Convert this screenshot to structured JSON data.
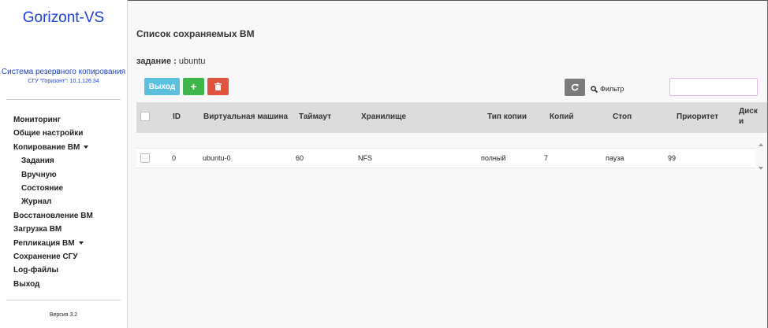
{
  "sidebar": {
    "brand": "Gorizont-VS",
    "subtitle": "Система резервного копирования",
    "server": "СГУ \"Горизонт\": 10.1.126.34",
    "items": [
      {
        "label": "Мониторинг"
      },
      {
        "label": "Общие настройки"
      },
      {
        "label": "Копирование ВМ"
      },
      {
        "label": "Задания"
      },
      {
        "label": "Вручную"
      },
      {
        "label": "Состояние"
      },
      {
        "label": "Журнал"
      },
      {
        "label": "Восстановление ВМ"
      },
      {
        "label": "Загрузка ВМ"
      },
      {
        "label": "Репликация ВМ"
      },
      {
        "label": "Сохранение СГУ"
      },
      {
        "label": "Log-файлы"
      },
      {
        "label": "Выход"
      }
    ],
    "version": "Версия 3.2"
  },
  "main": {
    "title": "Список сохраняемых ВМ",
    "task_label": "задание :",
    "task_value": "ubuntu",
    "exit_button": "Выход",
    "filter_label": "Фильтр",
    "filter_value": ""
  },
  "table": {
    "headers": [
      "ID",
      "Виртуальная машина",
      "Таймаут",
      "Хранилище",
      "Тип копии",
      "Копий",
      "Стоп",
      "Приоритет",
      "Диск",
      "и"
    ],
    "rows": [
      [
        "0",
        "ubuntu-0",
        "60",
        "NFS",
        "полный",
        "7",
        "пауза",
        "99"
      ]
    ]
  },
  "icons": {
    "add": "plus-icon",
    "delete": "trash-icon",
    "refresh": "refresh-icon",
    "filter": "search-icon"
  },
  "colors": {
    "brand": "#1d3fd6",
    "exit_button": "#5bc0de",
    "add_button": "#3cb54a",
    "delete_button": "#e0533f",
    "refresh_button": "#7a7a7a"
  }
}
